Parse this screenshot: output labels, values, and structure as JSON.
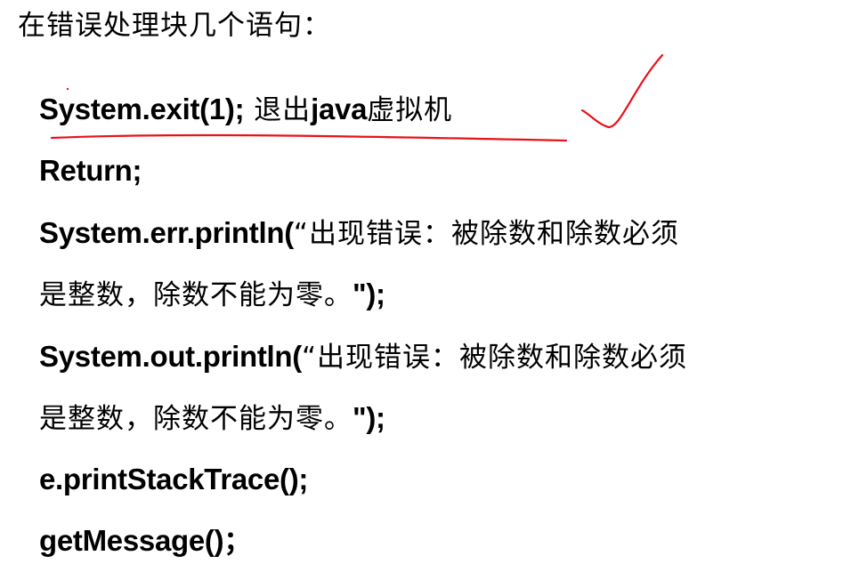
{
  "heading": "在错误处理块几个语句：",
  "lines": [
    {
      "code": "System.exit(1);",
      "text": " 退出",
      "code2": "java",
      "text2": "虚拟机"
    },
    {
      "code": "Return;"
    },
    {
      "code": "System.err.println(",
      "text": "“出现错误：被除数和除数必须"
    },
    {
      "text": "是整数，除数不能为零。",
      "code": "\");"
    },
    {
      "code": "System.out.println(",
      "text": "“出现错误：被除数和除数必须"
    },
    {
      "text": "是整数，除数不能为零。",
      "code": "\");"
    },
    {
      "code": "e.printStackTrace();"
    },
    {
      "code": "getMessage()",
      "text": "；"
    }
  ],
  "annotation": {
    "color": "#e8121a",
    "underline_target": "System.exit(1); 退出java虚拟机",
    "mark": "checkmark"
  }
}
